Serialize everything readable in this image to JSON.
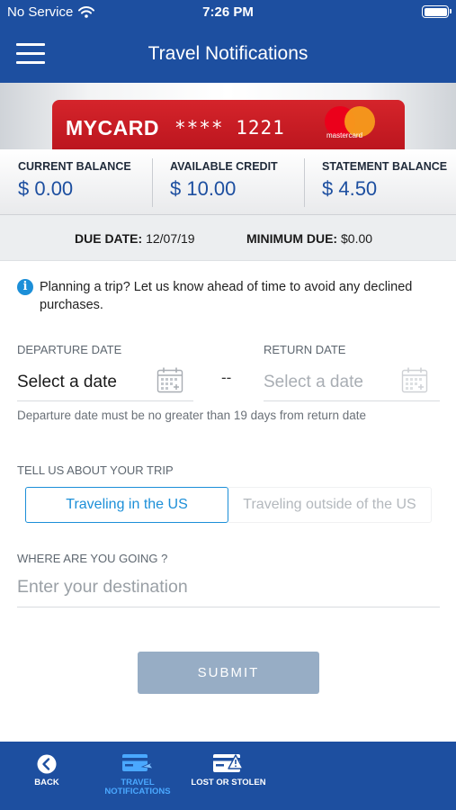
{
  "status_bar": {
    "carrier": "No Service",
    "time": "7:26 PM"
  },
  "header": {
    "title": "Travel Notifications"
  },
  "card": {
    "name": "MYCARD",
    "number_masked": "**** 1221",
    "network_text": "mastercard",
    "color": "#c81a22"
  },
  "balances": [
    {
      "label": "CURRENT BALANCE",
      "value": "$ 0.00"
    },
    {
      "label": "AVAILABLE CREDIT",
      "value": "$ 10.00"
    },
    {
      "label": "STATEMENT BALANCE",
      "value": "$ 4.50"
    }
  ],
  "due": {
    "due_date_label": "DUE DATE:",
    "due_date_value": "12/07/19",
    "min_due_label": "MINIMUM DUE:",
    "min_due_value": "$0.00"
  },
  "info": {
    "icon": "info-icon",
    "text": "Planning a trip? Let us know ahead of time to avoid any declined purchases."
  },
  "dates": {
    "departure_label": "DEPARTURE DATE",
    "departure_value": "Select a date",
    "return_label": "RETURN DATE",
    "return_value": "Select a date",
    "separator": "--",
    "hint": "Departure date must be no greater than 19 days from return date"
  },
  "trip": {
    "label": "TELL US ABOUT YOUR TRIP",
    "options": [
      "Traveling in the US",
      "Traveling outside of the US"
    ],
    "selected": "Traveling in the US"
  },
  "destination": {
    "label": "WHERE ARE YOU GOING ?",
    "placeholder": "Enter your destination",
    "value": ""
  },
  "submit": {
    "label": "SUBMIT"
  },
  "tabs": [
    {
      "label": "BACK",
      "icon": "back-arrow-icon"
    },
    {
      "label": "TRAVEL NOTIFICATIONS",
      "icon": "card-plane-icon",
      "active": true
    },
    {
      "label": "LOST OR STOLEN",
      "icon": "card-warning-icon"
    }
  ],
  "colors": {
    "primary": "#1d4fa0",
    "accent": "#1c8fd8",
    "submit_disabled": "#97adc5",
    "active_tab_text": "#4aa8ff"
  }
}
